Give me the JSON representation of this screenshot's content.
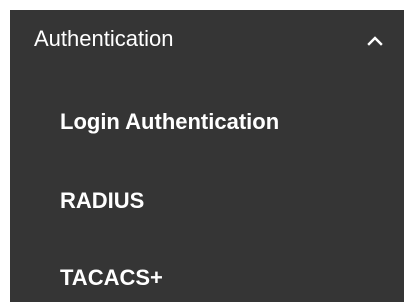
{
  "menu": {
    "section_label": "Authentication",
    "expanded_icon": "chevron-up-icon",
    "items": [
      {
        "label": "Login Authentication"
      },
      {
        "label": "RADIUS"
      },
      {
        "label": "TACACS+"
      }
    ]
  },
  "colors": {
    "panel_background": "#353535",
    "text": "#ffffff"
  }
}
